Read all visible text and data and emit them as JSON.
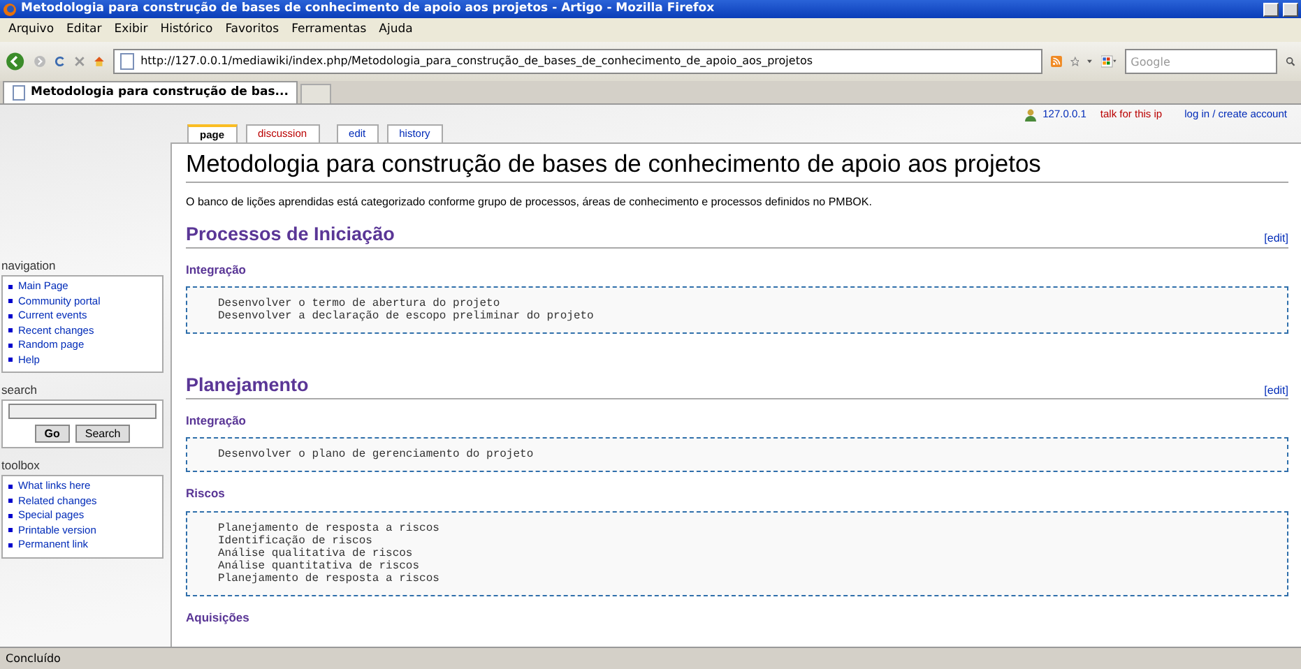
{
  "window": {
    "title": "Metodologia para construção de bases de conhecimento de apoio aos projetos - Artigo - Mozilla Firefox"
  },
  "menu": [
    "Arquivo",
    "Editar",
    "Exibir",
    "Histórico",
    "Favoritos",
    "Ferramentas",
    "Ajuda"
  ],
  "toolbar": {
    "url": "http://127.0.0.1/mediawiki/index.php/Metodologia_para_construção_de_bases_de_conhecimento_de_apoio_aos_projetos",
    "search": {
      "placeholder": "Google"
    }
  },
  "browser_tabs": [
    {
      "label": "Metodologia para construção de bas...",
      "selected": true
    }
  ],
  "personal": {
    "ip": "127.0.0.1",
    "links": [
      "talk for this ip",
      "log in / create account"
    ]
  },
  "page_tabs": [
    {
      "label": "page",
      "selected": true,
      "kind": "main"
    },
    {
      "label": "discussion",
      "selected": false,
      "kind": "new"
    },
    {
      "label": "edit",
      "selected": false,
      "kind": "action"
    },
    {
      "label": "history",
      "selected": false,
      "kind": "action"
    }
  ],
  "sidebar": {
    "portlets": [
      {
        "kind": "links",
        "title": "navigation",
        "items": [
          "Main Page",
          "Community portal",
          "Current events",
          "Recent changes",
          "Random page",
          "Help"
        ]
      },
      {
        "kind": "search",
        "title": "search",
        "buttons": [
          "Go",
          "Search"
        ]
      },
      {
        "kind": "links",
        "title": "toolbox",
        "items": [
          "What links here",
          "Related changes",
          "Special pages",
          "Printable version",
          "Permanent link"
        ]
      }
    ]
  },
  "article": {
    "title": "Metodologia para construção de bases de conhecimento de apoio aos projetos",
    "intro": "O banco de lições aprendidas está categorizado conforme grupo de processos, áreas de conhecimento e processos definidos no PMBOK.",
    "sections": [
      {
        "heading": "Processos de Iniciação",
        "edit": "[edit]",
        "subsections": [
          {
            "heading": "Integração",
            "lines": [
              "Desenvolver o termo de abertura do projeto",
              "Desenvolver a declaração de escopo preliminar do projeto"
            ]
          }
        ]
      },
      {
        "heading": "Planejamento",
        "edit": "[edit]",
        "subsections": [
          {
            "heading": "Integração",
            "lines": [
              "Desenvolver o plano de gerenciamento do projeto"
            ]
          },
          {
            "heading": "Riscos",
            "lines": [
              "Planejamento de resposta a riscos",
              "Identificação de riscos",
              "Análise qualitativa de riscos",
              "Análise quantitativa de riscos",
              "Planejamento de resposta a riscos"
            ]
          },
          {
            "heading": "Aquisições"
          }
        ]
      }
    ]
  },
  "status_bar": {
    "text": "Concluído"
  }
}
